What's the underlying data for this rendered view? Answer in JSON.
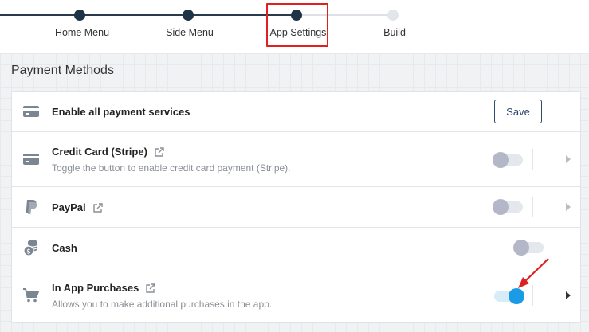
{
  "stepper": {
    "steps": [
      {
        "label": "Home Menu",
        "state": "done"
      },
      {
        "label": "Side Menu",
        "state": "done"
      },
      {
        "label": "App Settings",
        "state": "current"
      },
      {
        "label": "Build",
        "state": "pending"
      }
    ],
    "highlight_color": "#e02020"
  },
  "section": {
    "title": "Payment Methods"
  },
  "payment": {
    "header": {
      "label": "Enable all payment services",
      "icon": "credit-card-icon",
      "save_label": "Save"
    },
    "rows": [
      {
        "title": "Credit Card (Stripe)",
        "description": "Toggle the button to enable credit card payment (Stripe).",
        "icon": "credit-card-icon",
        "enabled": false,
        "has_external_link": true,
        "has_chevron": true
      },
      {
        "title": "PayPal",
        "description": "",
        "icon": "paypal-icon",
        "enabled": false,
        "has_external_link": true,
        "has_chevron": true
      },
      {
        "title": "Cash",
        "description": "",
        "icon": "coins-icon",
        "enabled": false,
        "has_external_link": false,
        "has_chevron": false
      },
      {
        "title": "In App Purchases",
        "description": "Allows you to make additional purchases in the app.",
        "icon": "shopping-cart-icon",
        "enabled": true,
        "has_external_link": true,
        "has_chevron": true
      }
    ]
  },
  "colors": {
    "toggle_on": "#1b9ae6",
    "toggle_off_knob": "#b3b7c8",
    "stepper_dark": "#1f3347",
    "annotation_arrow": "#e02020"
  }
}
